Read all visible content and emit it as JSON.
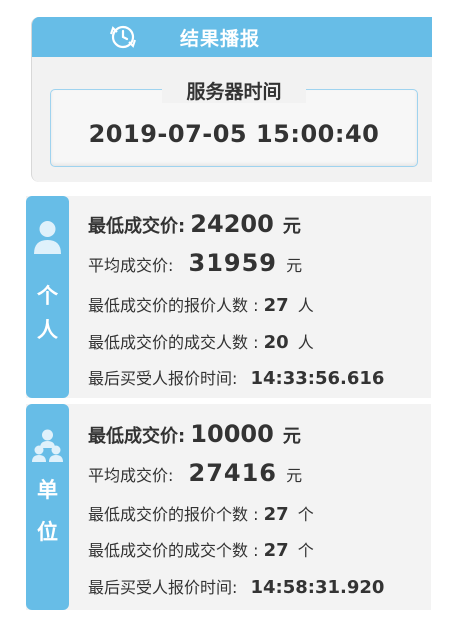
{
  "header": {
    "title": "结果播报",
    "server_label": "服务器时间",
    "server_time": "2019-07-05 15:00:40"
  },
  "personal": {
    "side_chars": [
      "个",
      "人"
    ],
    "lowest_price_label": "最低成交价:",
    "lowest_price_value": "24200",
    "lowest_price_unit": "元",
    "avg_price_label": "平均成交价:",
    "avg_price_value": "31959",
    "avg_price_unit": "元",
    "bidders_label": "最低成交价的报价人数 :",
    "bidders_value": "27",
    "bidders_unit": "人",
    "deals_label": "最低成交价的成交人数 :",
    "deals_value": "20",
    "deals_unit": "人",
    "last_time_label": "最后买受人报价时间:",
    "last_time_value": "14:33:56.616"
  },
  "unit": {
    "side_chars": [
      "单",
      "位"
    ],
    "lowest_price_label": "最低成交价:",
    "lowest_price_value": "10000",
    "lowest_price_unit": "元",
    "avg_price_label": "平均成交价:",
    "avg_price_value": "27416",
    "avg_price_unit": "元",
    "bidders_label": "最低成交价的报价个数 :",
    "bidders_value": "27",
    "bidders_unit": "个",
    "deals_label": "最低成交价的成交个数 :",
    "deals_value": "27",
    "deals_unit": "个",
    "last_time_label": "最后买受人报价时间:",
    "last_time_value": "14:58:31.920"
  },
  "colors": {
    "accent": "#67bde7",
    "panel_bg": "#f3f3f3",
    "text": "#333333"
  },
  "icons": {
    "header": "refresh-clock-icon",
    "personal": "person-icon",
    "unit": "group-icon"
  }
}
